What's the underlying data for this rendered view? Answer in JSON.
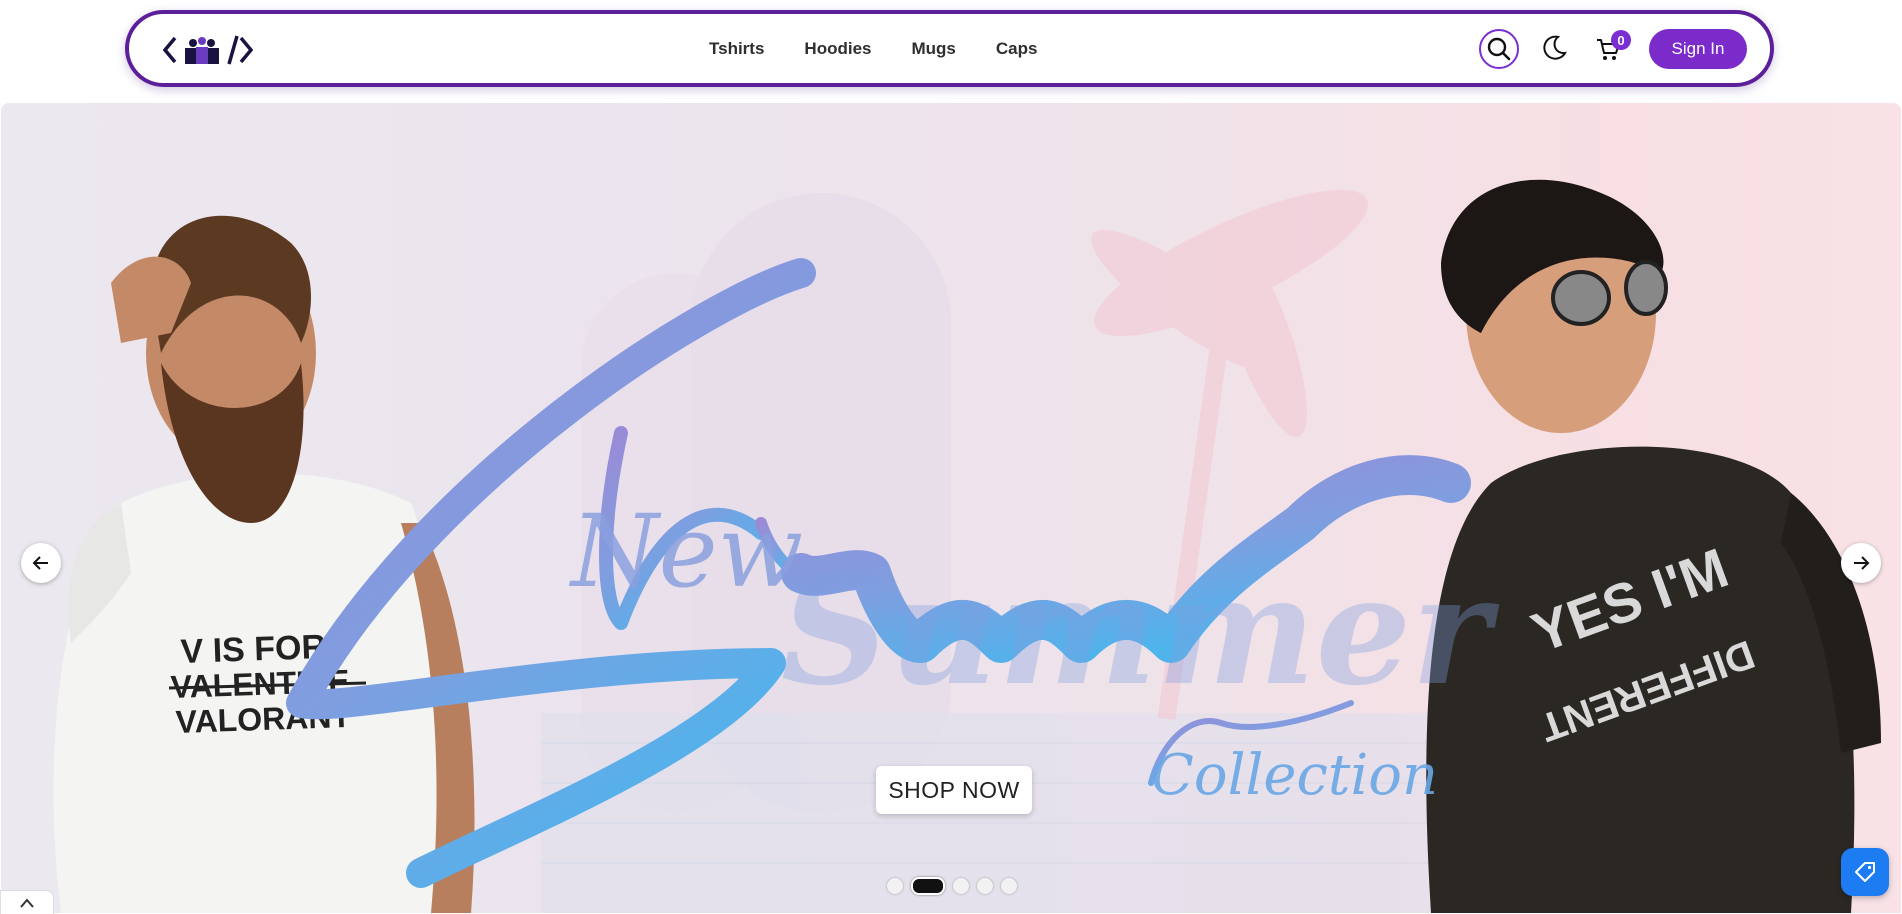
{
  "header": {
    "logo_icon": "code-brackets-with-people-logo",
    "nav": [
      {
        "label": "Tshirts"
      },
      {
        "label": "Hoodies"
      },
      {
        "label": "Mugs"
      },
      {
        "label": "Caps"
      }
    ],
    "search_icon": "search-icon",
    "theme_icon": "moon-icon",
    "cart_icon": "cart-icon",
    "cart_count": "0",
    "signin_label": "Sign In",
    "brand_color": "#7a2bc9"
  },
  "hero": {
    "headline_word_1": "New",
    "headline_word_2": "Summer",
    "headline_word_3": "Collection",
    "left_shirt_print": [
      "V IS FOR",
      "VALENTINE",
      "VALORANT"
    ],
    "right_shirt_print": [
      "YES I'M",
      "DIFFERENT"
    ],
    "cta_label": "SHOP NOW",
    "slide_count": 5,
    "active_slide": 2,
    "prev_icon": "arrow-left-icon",
    "next_icon": "arrow-right-icon",
    "coupon_icon": "tag-icon",
    "scroll_top_icon": "chevron-up-icon"
  }
}
